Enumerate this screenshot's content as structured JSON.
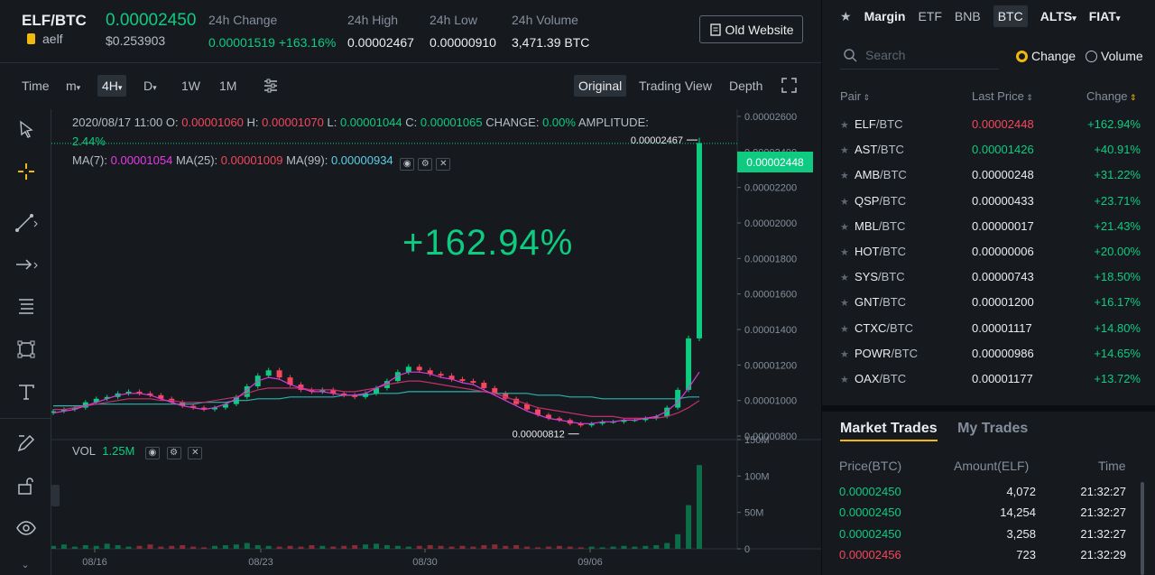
{
  "header": {
    "pair": "ELF/BTC",
    "coin_name": "aelf",
    "last_price": "0.00002450",
    "usd_price": "$0.253903",
    "stats": [
      {
        "label": "24h Change",
        "value": "0.00001519 +163.16%",
        "color": "green"
      },
      {
        "label": "24h High",
        "value": "0.00002467",
        "color": "white"
      },
      {
        "label": "24h Low",
        "value": "0.00000910",
        "color": "white"
      },
      {
        "label": "24h Volume",
        "value": "3,471.39 BTC",
        "color": "white"
      }
    ],
    "old_website_label": "Old Website"
  },
  "toolbar": {
    "time": "Time",
    "minute": "m",
    "four_h": "4H",
    "day": "D",
    "week": "1W",
    "month": "1M",
    "original": "Original",
    "trading_view": "Trading View",
    "depth": "Depth"
  },
  "chart_info": {
    "date": "2020/08/17 11:00",
    "o_label": "O:",
    "o": "0.00001060",
    "h_label": "H:",
    "h": "0.00001070",
    "l_label": "L:",
    "l": "0.00001044",
    "c_label": "C:",
    "c": "0.00001065",
    "change_label": "CHANGE:",
    "change": "0.00%",
    "amp_label": "AMPLITUDE:",
    "amp": "2.44%",
    "ma7_label": "MA(7):",
    "ma7": "0.00001054",
    "ma25_label": "MA(25):",
    "ma25": "0.00001009",
    "ma99_label": "MA(99):",
    "ma99": "0.00000934",
    "big_change": "+162.94%",
    "current_price_tag": "0.00002448",
    "high_marker": "0.00002467",
    "low_marker": "0.00000812",
    "vol_label": "VOL",
    "vol_value": "1.25M"
  },
  "chart_data": {
    "type": "candlestick",
    "price_ticks": [
      "0.00002600",
      "0.00002400",
      "0.00002200",
      "0.00002000",
      "0.00001800",
      "0.00001600",
      "0.00001400",
      "0.00001200",
      "0.00001000",
      "0.00000800"
    ],
    "volume_ticks": [
      "150M",
      "100M",
      "50M",
      "0"
    ],
    "x_ticks": [
      "08/16",
      "08/23",
      "08/30",
      "09/06"
    ],
    "ylim": [
      7.8e-06,
      2.62e-05
    ],
    "close_series": [
      9.4e-06,
      9.5e-06,
      9.6e-06,
      9.9e-06,
      1.01e-05,
      1.02e-05,
      1.04e-05,
      1.05e-05,
      1.04e-05,
      1.03e-05,
      1.01e-05,
      9.9e-06,
      9.7e-06,
      9.6e-06,
      9.5e-06,
      9.6e-06,
      9.8e-06,
      1.02e-05,
      1.08e-05,
      1.14e-05,
      1.17e-05,
      1.13e-05,
      1.09e-05,
      1.06e-05,
      1.05e-05,
      1.06e-05,
      1.04e-05,
      1.03e-05,
      1.02e-05,
      1.04e-05,
      1.07e-05,
      1.11e-05,
      1.16e-05,
      1.19e-05,
      1.17e-05,
      1.15e-05,
      1.14e-05,
      1.12e-05,
      1.11e-05,
      1.1e-05,
      1.07e-05,
      1.04e-05,
      1.01e-05,
      9.8e-06,
      9.5e-06,
      9.2e-06,
      9e-06,
      8.9e-06,
      8.7e-06,
      8.6e-06,
      8.7e-06,
      8.8e-06,
      8.8e-06,
      8.9e-06,
      8.9e-06,
      9e-06,
      9.1e-06,
      9.6e-06,
      1.06e-05,
      1.35e-05,
      2.45e-05
    ],
    "ma7": [
      9.3e-06,
      9.4e-06,
      9.5e-06,
      9.7e-06,
      9.9e-06,
      1.01e-05,
      1.03e-05,
      1.04e-05,
      1.04e-05,
      1.03e-05,
      1.01e-05,
      9.9e-06,
      9.7e-06,
      9.6e-06,
      9.5e-06,
      9.6e-06,
      9.8e-06,
      1.01e-05,
      1.06e-05,
      1.11e-05,
      1.13e-05,
      1.12e-05,
      1.09e-05,
      1.07e-05,
      1.05e-05,
      1.05e-05,
      1.04e-05,
      1.03e-05,
      1.03e-05,
      1.04e-05,
      1.07e-05,
      1.1e-05,
      1.14e-05,
      1.16e-05,
      1.16e-05,
      1.15e-05,
      1.13e-05,
      1.12e-05,
      1.1e-05,
      1.09e-05,
      1.06e-05,
      1.03e-05,
      1e-05,
      9.7e-06,
      9.4e-06,
      9.2e-06,
      9e-06,
      8.9e-06,
      8.8e-06,
      8.7e-06,
      8.7e-06,
      8.8e-06,
      8.8e-06,
      8.9e-06,
      8.9e-06,
      9e-06,
      9.1e-06,
      9.4e-06,
      9.9e-06,
      1.07e-05,
      1.16e-05
    ],
    "ma25": [
      9.5e-06,
      9.5e-06,
      9.6e-06,
      9.7e-06,
      9.8e-06,
      9.9e-06,
      1e-05,
      1.01e-05,
      1.01e-05,
      1.01e-05,
      1e-05,
      1e-05,
      9.9e-06,
      9.9e-06,
      9.9e-06,
      1e-05,
      1.01e-05,
      1.02e-05,
      1.04e-05,
      1.06e-05,
      1.07e-05,
      1.07e-05,
      1.07e-05,
      1.07e-05,
      1.06e-05,
      1.06e-05,
      1.06e-05,
      1.05e-05,
      1.05e-05,
      1.06e-05,
      1.07e-05,
      1.09e-05,
      1.1e-05,
      1.11e-05,
      1.11e-05,
      1.1e-05,
      1.09e-05,
      1.08e-05,
      1.07e-05,
      1.06e-05,
      1.05e-05,
      1.04e-05,
      1.02e-05,
      1e-05,
      9.8e-06,
      9.6e-06,
      9.5e-06,
      9.4e-06,
      9.3e-06,
      9.2e-06,
      9.1e-06,
      9.1e-06,
      9.1e-06,
      9e-06,
      9e-06,
      9e-06,
      9e-06,
      9.1e-06,
      9.3e-06,
      9.6e-06,
      1e-05
    ],
    "ma99": [
      9.7e-06,
      9.7e-06,
      9.7e-06,
      9.7e-06,
      9.8e-06,
      9.8e-06,
      9.8e-06,
      9.8e-06,
      9.8e-06,
      9.8e-06,
      9.8e-06,
      9.8e-06,
      9.8e-06,
      9.8e-06,
      9.9e-06,
      9.9e-06,
      9.9e-06,
      1e-05,
      1e-05,
      1.01e-05,
      1.01e-05,
      1.01e-05,
      1.02e-05,
      1.02e-05,
      1.02e-05,
      1.02e-05,
      1.02e-05,
      1.03e-05,
      1.03e-05,
      1.03e-05,
      1.04e-05,
      1.04e-05,
      1.04e-05,
      1.05e-05,
      1.05e-05,
      1.05e-05,
      1.05e-05,
      1.05e-05,
      1.05e-05,
      1.05e-05,
      1.05e-05,
      1.04e-05,
      1.04e-05,
      1.04e-05,
      1.04e-05,
      1.03e-05,
      1.03e-05,
      1.03e-05,
      1.02e-05,
      1.02e-05,
      1.02e-05,
      1.01e-05,
      1.01e-05,
      1.01e-05,
      1.01e-05,
      1.01e-05,
      1.01e-05,
      1.01e-05,
      1.01e-05,
      1.02e-05,
      1.02e-05
    ],
    "volume_series": [
      4,
      6,
      3,
      5,
      4,
      7,
      5,
      3,
      4,
      6,
      3,
      4,
      5,
      3,
      2,
      4,
      5,
      6,
      8,
      5,
      4,
      3,
      4,
      3,
      5,
      4,
      3,
      4,
      5,
      6,
      7,
      5,
      4,
      3,
      4,
      5,
      4,
      3,
      4,
      3,
      5,
      6,
      4,
      5,
      3,
      2,
      3,
      4,
      3,
      2,
      3,
      2,
      3,
      4,
      3,
      4,
      5,
      8,
      20,
      60,
      115
    ],
    "vol_ylim": [
      0,
      150
    ]
  },
  "markets": {
    "tabs": [
      "Margin",
      "ETF",
      "BNB",
      "BTC",
      "ALTS",
      "FIAT"
    ],
    "search_placeholder": "Search",
    "radio_change": "Change",
    "radio_volume": "Volume",
    "col_pair": "Pair",
    "col_last": "Last Price",
    "col_change": "Change",
    "rows": [
      {
        "base": "ELF",
        "quote": "/BTC",
        "price": "0.00002448",
        "change": "+162.94%",
        "color": "red"
      },
      {
        "base": "AST",
        "quote": "/BTC",
        "price": "0.00001426",
        "change": "+40.91%",
        "color": "green"
      },
      {
        "base": "AMB",
        "quote": "/BTC",
        "price": "0.00000248",
        "change": "+31.22%",
        "color": "white"
      },
      {
        "base": "QSP",
        "quote": "/BTC",
        "price": "0.00000433",
        "change": "+23.71%",
        "color": "white"
      },
      {
        "base": "MBL",
        "quote": "/BTC",
        "price": "0.00000017",
        "change": "+21.43%",
        "color": "white"
      },
      {
        "base": "HOT",
        "quote": "/BTC",
        "price": "0.00000006",
        "change": "+20.00%",
        "color": "white"
      },
      {
        "base": "SYS",
        "quote": "/BTC",
        "price": "0.00000743",
        "change": "+18.50%",
        "color": "white"
      },
      {
        "base": "GNT",
        "quote": "/BTC",
        "price": "0.00001200",
        "change": "+16.17%",
        "color": "white"
      },
      {
        "base": "CTXC",
        "quote": "/BTC",
        "price": "0.00001117",
        "change": "+14.80%",
        "color": "white"
      },
      {
        "base": "POWR",
        "quote": "/BTC",
        "price": "0.00000986",
        "change": "+14.65%",
        "color": "white"
      },
      {
        "base": "OAX",
        "quote": "/BTC",
        "price": "0.00001177",
        "change": "+13.72%",
        "color": "white"
      }
    ]
  },
  "trades": {
    "tab_market": "Market Trades",
    "tab_my": "My Trades",
    "col_price": "Price(BTC)",
    "col_amount": "Amount(ELF)",
    "col_time": "Time",
    "rows": [
      {
        "price": "0.00002450",
        "amount": "4,072",
        "time": "21:32:27",
        "color": "green"
      },
      {
        "price": "0.00002450",
        "amount": "14,254",
        "time": "21:32:27",
        "color": "green"
      },
      {
        "price": "0.00002450",
        "amount": "3,258",
        "time": "21:32:27",
        "color": "green"
      },
      {
        "price": "0.00002456",
        "amount": "723",
        "time": "21:32:29",
        "color": "red"
      }
    ]
  },
  "colors": {
    "green": "#0ecb81",
    "red": "#f6465d",
    "accent": "#f0b90b",
    "bg": "#161a1e"
  }
}
